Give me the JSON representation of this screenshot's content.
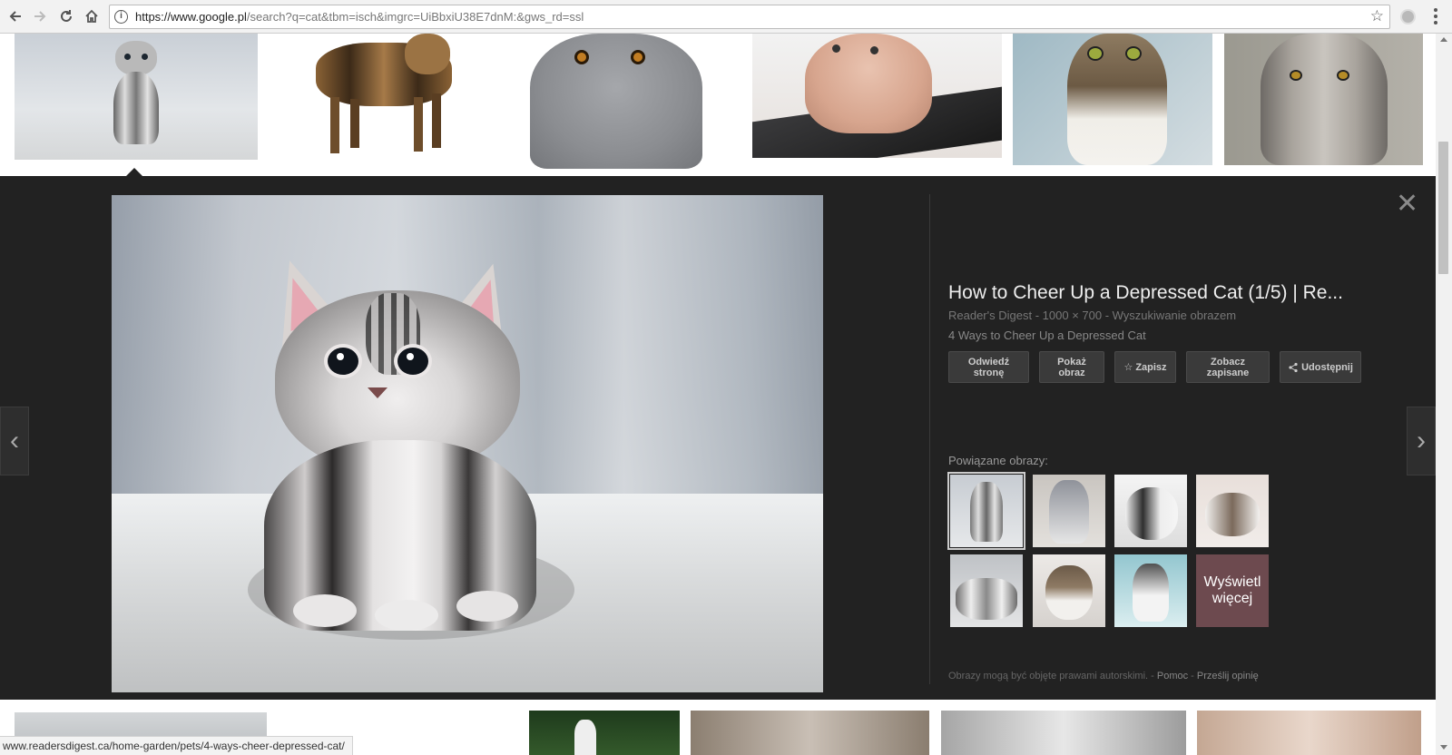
{
  "browser": {
    "url_host": "https://www.google.pl",
    "url_rest": "/search?q=cat&tbm=isch&imgrc=UiBbxiU38E7dnM:&gws_rd=ssl"
  },
  "viewer": {
    "title": "How to Cheer Up a Depressed Cat (1/5) | Re...",
    "source": "Reader's Digest",
    "dimensions": "1000 × 700",
    "search_by_image": "Wyszukiwanie obrazem",
    "description": "4 Ways to Cheer Up a Depressed Cat",
    "actions": {
      "visit": "Odwiedź stronę",
      "view": "Pokaż obraz",
      "save": "Zapisz",
      "view_saved": "Zobacz zapisane",
      "share": "Udostępnij"
    },
    "related_label": "Powiązane obrazy:",
    "more_label": "Wyświetl więcej",
    "copyright_note": "Obrazy mogą być objęte prawami autorskimi.",
    "help_link": "Pomoc",
    "feedback_link": "Prześlij opinię"
  },
  "status_bar": {
    "url": "www.readersdigest.ca/home-garden/pets/4-ways-cheer-depressed-cat/"
  },
  "colors": {
    "viewer_bg": "#222222",
    "title": "#eeeeee",
    "button_bg": "#3a3a3a"
  },
  "icons": [
    "back-arrow-icon",
    "forward-arrow-icon",
    "reload-icon",
    "home-icon",
    "info-icon",
    "star-icon",
    "close-icon",
    "chevron-left-icon",
    "chevron-right-icon",
    "share-icon"
  ]
}
